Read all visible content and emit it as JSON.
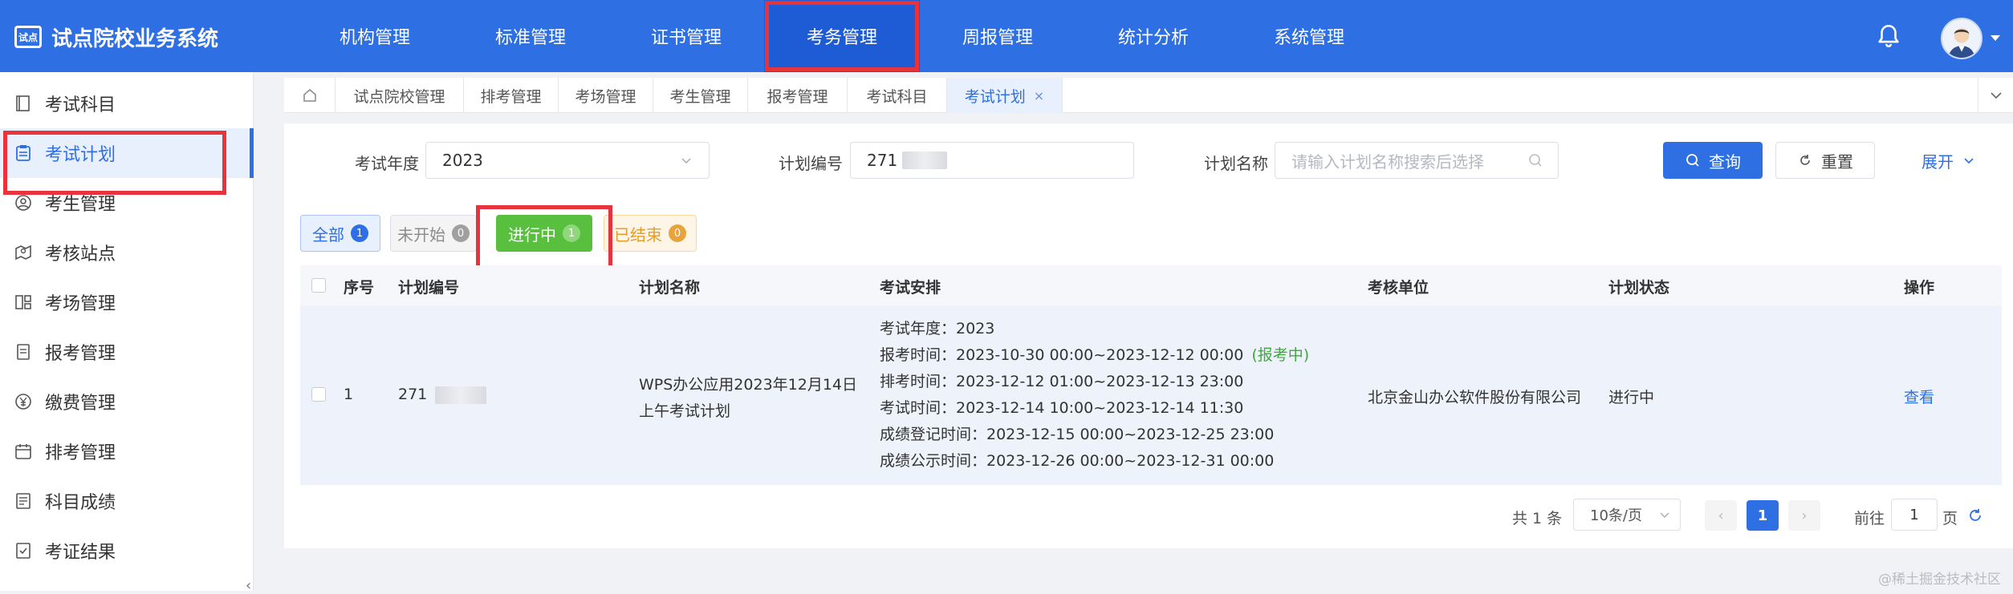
{
  "app": {
    "logo_text": "试点",
    "title": "试点院校业务系统"
  },
  "topnav": [
    {
      "label": "机构管理"
    },
    {
      "label": "标准管理"
    },
    {
      "label": "证书管理"
    },
    {
      "label": "考务管理"
    },
    {
      "label": "周报管理"
    },
    {
      "label": "统计分析"
    },
    {
      "label": "系统管理"
    }
  ],
  "sidebar": {
    "items": [
      {
        "label": "考试科目"
      },
      {
        "label": "考试计划"
      },
      {
        "label": "考生管理"
      },
      {
        "label": "考核站点"
      },
      {
        "label": "考场管理"
      },
      {
        "label": "报考管理"
      },
      {
        "label": "缴费管理"
      },
      {
        "label": "排考管理"
      },
      {
        "label": "科目成绩"
      },
      {
        "label": "考证结果"
      }
    ],
    "collapse_glyph": "‹"
  },
  "tabs": [
    {
      "label": "试点院校管理"
    },
    {
      "label": "排考管理"
    },
    {
      "label": "考场管理"
    },
    {
      "label": "考生管理"
    },
    {
      "label": "报考管理"
    },
    {
      "label": "考试科目"
    },
    {
      "label": "考试计划",
      "close": "×"
    }
  ],
  "filters": {
    "year_label": "考试年度",
    "year_value": "2023",
    "code_label": "计划编号",
    "code_value": "271",
    "name_label": "计划名称",
    "name_placeholder": "请输入计划名称搜索后选择",
    "query_button": "查询",
    "reset_button": "重置",
    "expand_button": "展开"
  },
  "status_tabs": {
    "all": {
      "label": "全部",
      "count": "1"
    },
    "not_started": {
      "label": "未开始",
      "count": "0"
    },
    "in_progress": {
      "label": "进行中",
      "count": "1"
    },
    "ended": {
      "label": "已结束",
      "count": "0"
    }
  },
  "table": {
    "headers": {
      "index": "序号",
      "code": "计划编号",
      "name": "计划名称",
      "schedule": "考试安排",
      "unit": "考核单位",
      "status": "计划状态",
      "action": "操作"
    },
    "rows": [
      {
        "index": "1",
        "code": "271",
        "name_line1": "WPS办公应用2023年12月14日",
        "name_line2": "上午考试计划",
        "schedule": [
          "考试年度：2023",
          "报考时间：2023-10-30 00:00~2023-12-12 00:00",
          "排考时间：2023-12-12 01:00~2023-12-13 23:00",
          "考试时间：2023-12-14 10:00~2023-12-14 11:30",
          "成绩登记时间：2023-12-15 00:00~2023-12-25 23:00",
          "成绩公示时间：2023-12-26 00:00~2023-12-31 00:00"
        ],
        "schedule_tag": "(报考中)",
        "unit": "北京金山办公软件股份有限公司",
        "status": "进行中",
        "action": "查看"
      }
    ]
  },
  "pagination": {
    "total": "共 1 条",
    "page_size": "10条/页",
    "prev": "‹",
    "current": "1",
    "next": "›",
    "goto_label": "前往",
    "goto_value": "1",
    "page_suffix": "页"
  },
  "watermark": "@稀土掘金技术社区",
  "colors": {
    "primary": "#2f6fe4",
    "highlight_red": "#e8323c",
    "in_progress_green": "#58c03e",
    "ended_orange": "#e69b2a"
  }
}
